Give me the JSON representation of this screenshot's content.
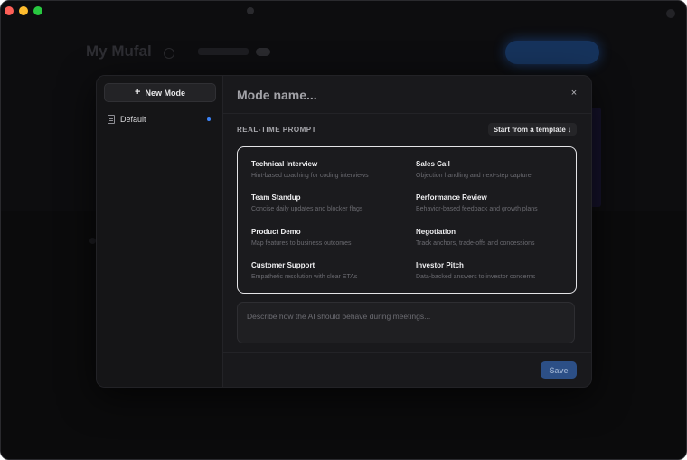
{
  "background": {
    "title": "My Mufal"
  },
  "modal": {
    "sidebar": {
      "new_mode_label": "New Mode",
      "items": [
        {
          "label": "Default",
          "active": true
        }
      ]
    },
    "mode_name_placeholder": "Mode name...",
    "close_symbol": "×",
    "section_label": "REAL-TIME PROMPT",
    "template_button_label": "Start from a template ↓",
    "templates": [
      {
        "name": "Technical Interview",
        "description": "Hint-based coaching for coding interviews"
      },
      {
        "name": "Sales Call",
        "description": "Objection handling and next-step capture"
      },
      {
        "name": "Team Standup",
        "description": "Concise daily updates and blocker flags"
      },
      {
        "name": "Performance Review",
        "description": "Behavior-based feedback and growth plans"
      },
      {
        "name": "Product Demo",
        "description": "Map features to business outcomes"
      },
      {
        "name": "Negotiation",
        "description": "Track anchors, trade-offs and concessions"
      },
      {
        "name": "Customer Support",
        "description": "Empathetic resolution with clear ETAs"
      },
      {
        "name": "Investor Pitch",
        "description": "Data-backed answers to investor concerns"
      }
    ],
    "prompt_placeholder": "Describe how the AI should behave during meetings...",
    "prompt_value": "",
    "save_label": "Save"
  },
  "colors": {
    "accent": "#3b82f6",
    "save_button": "#2c4f86"
  }
}
